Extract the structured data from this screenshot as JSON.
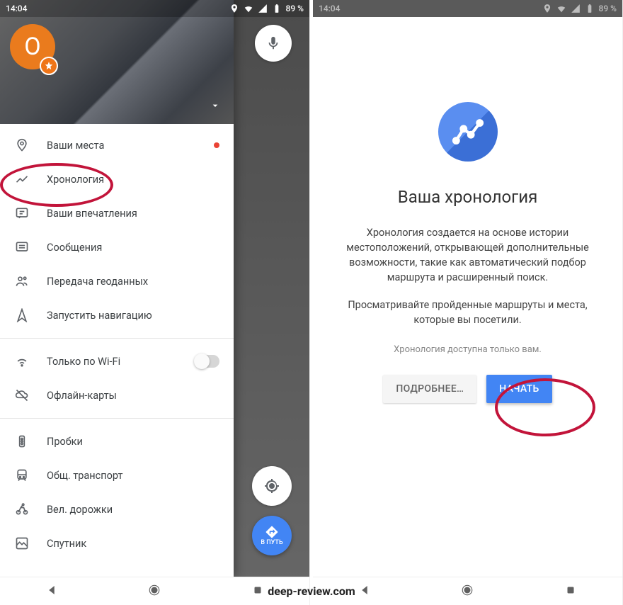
{
  "status": {
    "time": "14:04",
    "battery": "89 %"
  },
  "left": {
    "avatar_letter": "O",
    "go_label": "В ПУТЬ",
    "menu": [
      {
        "label": "Ваши места"
      },
      {
        "label": "Хронология"
      },
      {
        "label": "Ваши впечатления"
      },
      {
        "label": "Сообщения"
      },
      {
        "label": "Передача геоданных"
      },
      {
        "label": "Запустить навигацию"
      },
      {
        "label": "Только по Wi-Fi"
      },
      {
        "label": "Офлайн-карты"
      },
      {
        "label": "Пробки"
      },
      {
        "label": "Общ. транспорт"
      },
      {
        "label": "Вел. дорожки"
      },
      {
        "label": "Спутник"
      }
    ]
  },
  "right": {
    "title": "Ваша хронология",
    "body1": "Хронология создается на основе истории местоположений, открывающей дополнительные возможности, такие как автоматический подбор маршрута и расширенный поиск.",
    "body2": "Просматривайте пройденные маршруты и места, которые вы посетили.",
    "footnote": "Хронология доступна только вам.",
    "btn_more": "ПОДРОБНЕЕ…",
    "btn_start": "НАЧАТЬ"
  },
  "watermark": "deep-review.com"
}
